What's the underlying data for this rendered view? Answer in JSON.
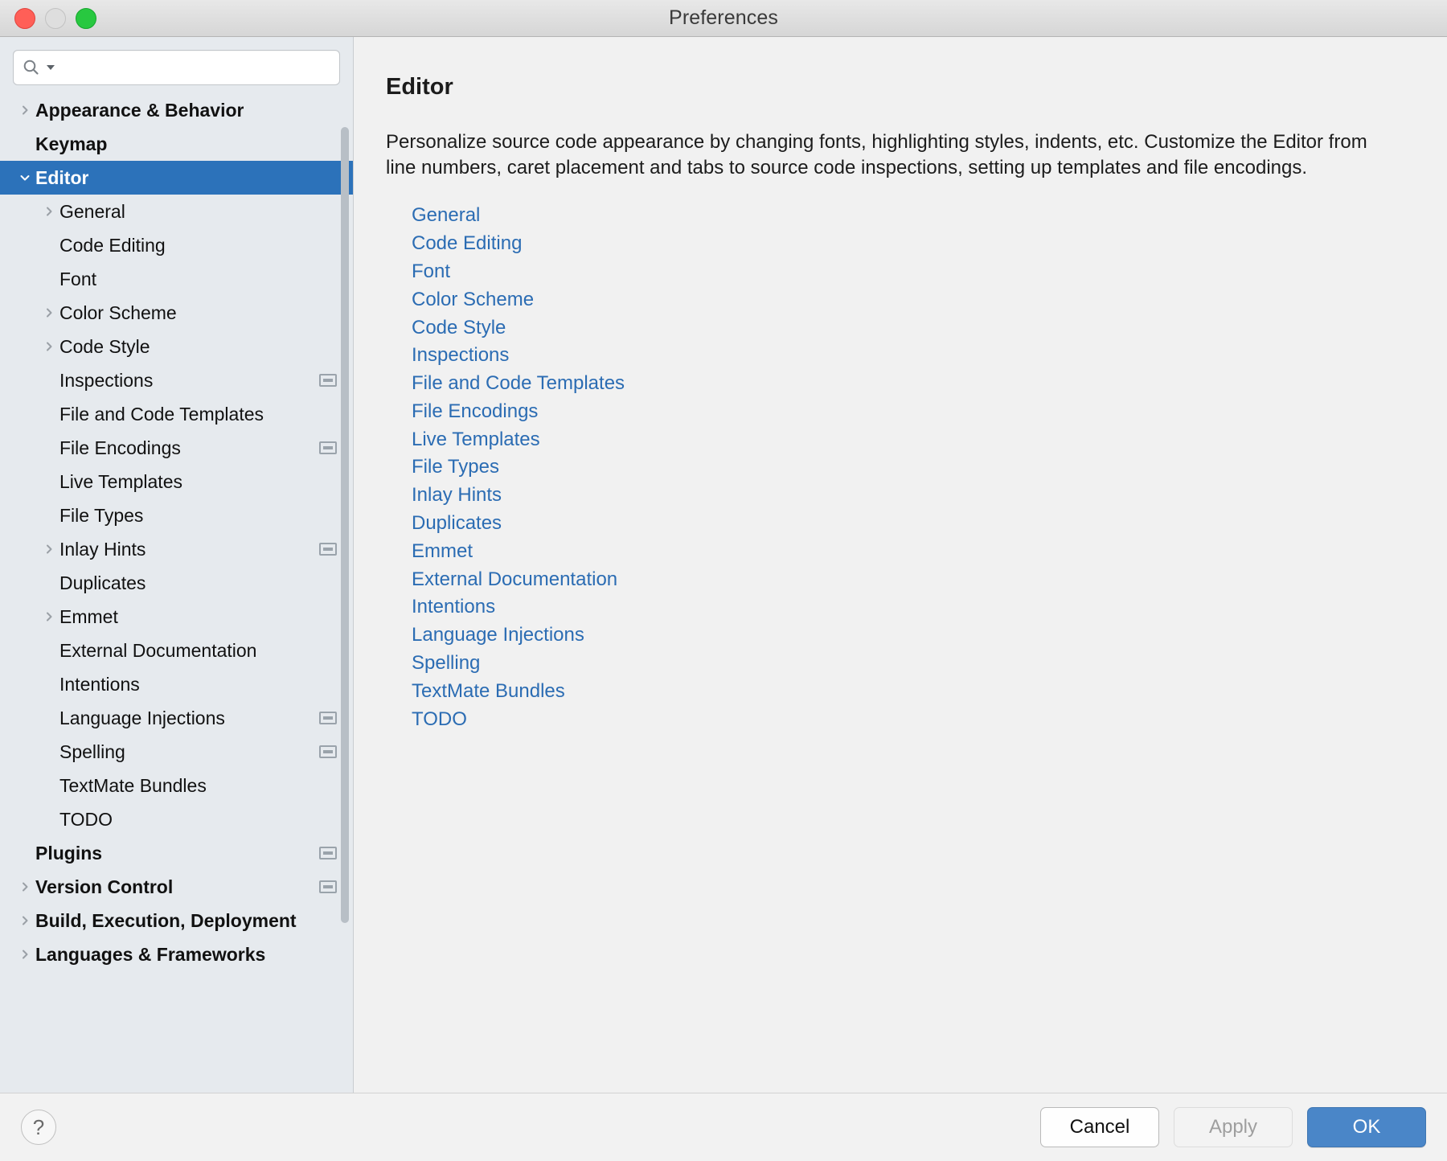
{
  "window": {
    "title": "Preferences",
    "traffic_lights": [
      "close-button",
      "minimize-button",
      "zoom-button"
    ]
  },
  "search": {
    "value": "",
    "placeholder": "",
    "icon": "search-icon",
    "dropdown_icon": "triangle-down-icon"
  },
  "sidebar": {
    "items": [
      {
        "label": "Appearance & Behavior",
        "level": 0,
        "bold": true,
        "arrow": "right",
        "badge": false,
        "selected": false
      },
      {
        "label": "Keymap",
        "level": 0,
        "bold": true,
        "arrow": "none",
        "badge": false,
        "selected": false
      },
      {
        "label": "Editor",
        "level": 0,
        "bold": true,
        "arrow": "down",
        "badge": false,
        "selected": true
      },
      {
        "label": "General",
        "level": 1,
        "bold": false,
        "arrow": "right",
        "badge": false,
        "selected": false
      },
      {
        "label": "Code Editing",
        "level": 1,
        "bold": false,
        "arrow": "none",
        "badge": false,
        "selected": false
      },
      {
        "label": "Font",
        "level": 1,
        "bold": false,
        "arrow": "none",
        "badge": false,
        "selected": false
      },
      {
        "label": "Color Scheme",
        "level": 1,
        "bold": false,
        "arrow": "right",
        "badge": false,
        "selected": false
      },
      {
        "label": "Code Style",
        "level": 1,
        "bold": false,
        "arrow": "right",
        "badge": false,
        "selected": false
      },
      {
        "label": "Inspections",
        "level": 1,
        "bold": false,
        "arrow": "none",
        "badge": true,
        "selected": false
      },
      {
        "label": "File and Code Templates",
        "level": 1,
        "bold": false,
        "arrow": "none",
        "badge": false,
        "selected": false
      },
      {
        "label": "File Encodings",
        "level": 1,
        "bold": false,
        "arrow": "none",
        "badge": true,
        "selected": false
      },
      {
        "label": "Live Templates",
        "level": 1,
        "bold": false,
        "arrow": "none",
        "badge": false,
        "selected": false
      },
      {
        "label": "File Types",
        "level": 1,
        "bold": false,
        "arrow": "none",
        "badge": false,
        "selected": false
      },
      {
        "label": "Inlay Hints",
        "level": 1,
        "bold": false,
        "arrow": "right",
        "badge": true,
        "selected": false
      },
      {
        "label": "Duplicates",
        "level": 1,
        "bold": false,
        "arrow": "none",
        "badge": false,
        "selected": false
      },
      {
        "label": "Emmet",
        "level": 1,
        "bold": false,
        "arrow": "right",
        "badge": false,
        "selected": false
      },
      {
        "label": "External Documentation",
        "level": 1,
        "bold": false,
        "arrow": "none",
        "badge": false,
        "selected": false
      },
      {
        "label": "Intentions",
        "level": 1,
        "bold": false,
        "arrow": "none",
        "badge": false,
        "selected": false
      },
      {
        "label": "Language Injections",
        "level": 1,
        "bold": false,
        "arrow": "none",
        "badge": true,
        "selected": false
      },
      {
        "label": "Spelling",
        "level": 1,
        "bold": false,
        "arrow": "none",
        "badge": true,
        "selected": false
      },
      {
        "label": "TextMate Bundles",
        "level": 1,
        "bold": false,
        "arrow": "none",
        "badge": false,
        "selected": false
      },
      {
        "label": "TODO",
        "level": 1,
        "bold": false,
        "arrow": "none",
        "badge": false,
        "selected": false
      },
      {
        "label": "Plugins",
        "level": 0,
        "bold": true,
        "arrow": "none",
        "badge": true,
        "selected": false
      },
      {
        "label": "Version Control",
        "level": 0,
        "bold": true,
        "arrow": "right",
        "badge": true,
        "selected": false
      },
      {
        "label": "Build, Execution, Deployment",
        "level": 0,
        "bold": true,
        "arrow": "right",
        "badge": false,
        "selected": false
      },
      {
        "label": "Languages & Frameworks",
        "level": 0,
        "bold": true,
        "arrow": "right",
        "badge": false,
        "selected": false
      }
    ]
  },
  "main": {
    "title": "Editor",
    "description": "Personalize source code appearance by changing fonts, highlighting styles, indents, etc. Customize the Editor from line numbers, caret placement and tabs to source code inspections, setting up templates and file encodings.",
    "links": [
      "General",
      "Code Editing",
      "Font",
      "Color Scheme",
      "Code Style",
      "Inspections",
      "File and Code Templates",
      "File Encodings",
      "Live Templates",
      "File Types",
      "Inlay Hints",
      "Duplicates",
      "Emmet",
      "External Documentation",
      "Intentions",
      "Language Injections",
      "Spelling",
      "TextMate Bundles",
      "TODO"
    ]
  },
  "footer": {
    "help_label": "?",
    "cancel_label": "Cancel",
    "apply_label": "Apply",
    "apply_enabled": false,
    "ok_label": "OK"
  },
  "colors": {
    "selection_blue": "#2c72ba",
    "link_blue": "#2b6cb3",
    "ok_button_blue": "#4a86c8",
    "sidebar_bg": "#e6eaee",
    "main_bg": "#f1f1f1"
  }
}
